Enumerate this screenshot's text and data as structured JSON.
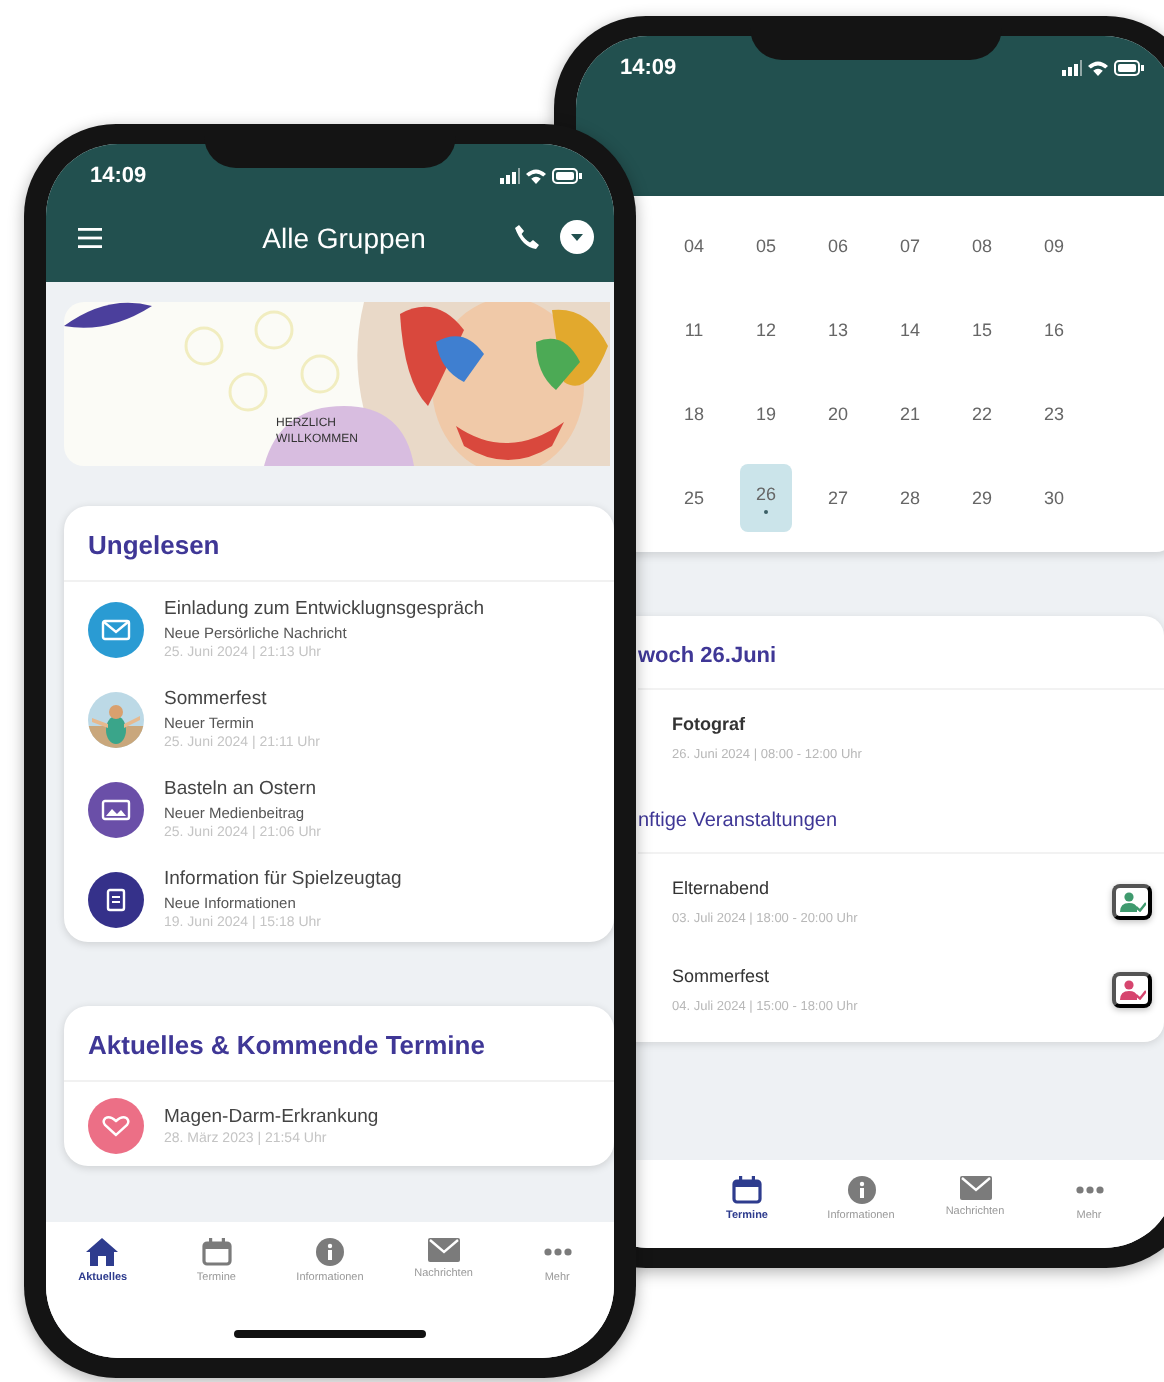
{
  "back_phone": {
    "status_time": "14:09",
    "calendar": [
      [
        {
          "day": "04",
          "selected": false,
          "event": false
        },
        {
          "day": "05",
          "selected": false,
          "event": false
        },
        {
          "day": "06",
          "selected": false,
          "event": false
        },
        {
          "day": "07",
          "selected": false,
          "event": false
        },
        {
          "day": "08",
          "selected": false,
          "event": false
        },
        {
          "day": "09",
          "selected": false,
          "event": false
        }
      ],
      [
        {
          "day": "11",
          "selected": false,
          "event": false
        },
        {
          "day": "12",
          "selected": false,
          "event": false
        },
        {
          "day": "13",
          "selected": false,
          "event": false
        },
        {
          "day": "14",
          "selected": false,
          "event": false
        },
        {
          "day": "15",
          "selected": false,
          "event": false
        },
        {
          "day": "16",
          "selected": false,
          "event": false
        }
      ],
      [
        {
          "day": "18",
          "selected": false,
          "event": false
        },
        {
          "day": "19",
          "selected": false,
          "event": false
        },
        {
          "day": "20",
          "selected": false,
          "event": false
        },
        {
          "day": "21",
          "selected": false,
          "event": false
        },
        {
          "day": "22",
          "selected": false,
          "event": false
        },
        {
          "day": "23",
          "selected": false,
          "event": false
        }
      ],
      [
        {
          "day": "25",
          "selected": false,
          "event": false
        },
        {
          "day": "26",
          "selected": true,
          "event": true
        },
        {
          "day": "27",
          "selected": false,
          "event": false
        },
        {
          "day": "28",
          "selected": false,
          "event": false
        },
        {
          "day": "29",
          "selected": false,
          "event": false
        },
        {
          "day": "30",
          "selected": false,
          "event": false
        }
      ]
    ],
    "day_heading": "woch 26.Juni",
    "today_events": [
      {
        "title": "Fotograf",
        "time": "26. Juni 2024 | 08:00 - 12:00 Uhr"
      }
    ],
    "upcoming_heading": "nftige Veranstaltungen",
    "upcoming": [
      {
        "title": "Elternabend",
        "time": "03. Juli 2024 | 18:00 - 20:00 Uhr",
        "color": "#3f9a6e"
      },
      {
        "title": "Sommerfest",
        "time": "04. Juli 2024 | 15:00 - 18:00 Uhr",
        "color": "#d6456e"
      }
    ],
    "tabs": [
      {
        "label": "Termine",
        "kind": "calendar",
        "selected": true
      },
      {
        "label": "Informationen",
        "kind": "info",
        "selected": false
      },
      {
        "label": "Nachrichten",
        "kind": "mail",
        "selected": false
      },
      {
        "label": "Mehr",
        "kind": "more",
        "selected": false
      }
    ]
  },
  "front_phone": {
    "status_time": "14:09",
    "title": "Alle Gruppen",
    "banner": {
      "text": "HERZLICH WILLKOMMEN"
    },
    "unread": {
      "heading": "Ungelesen",
      "items": [
        {
          "kind": "message",
          "title": "Einladung zum Entwicklugnsgespräch",
          "subtitle": "Neue Persörliche Nachricht",
          "time": "25. Juni 2024 | 21:13 Uhr"
        },
        {
          "kind": "picture",
          "title": "Sommerfest",
          "subtitle": "Neuer Termin",
          "time": "25. Juni 2024 | 21:11 Uhr"
        },
        {
          "kind": "media",
          "title": "Basteln an Ostern",
          "subtitle": "Neuer Medienbeitrag",
          "time": "25. Juni 2024 | 21:06 Uhr"
        },
        {
          "kind": "info",
          "title": "Information für Spielzeugtag",
          "subtitle": "Neue Informationen",
          "time": "19. Juni 2024 | 15:18 Uhr"
        }
      ]
    },
    "news": {
      "heading": "Aktuelles & Kommende Termine",
      "items": [
        {
          "kind": "health",
          "title": "Magen-Darm-Erkrankung",
          "time": "28. März 2023 | 21:54 Uhr"
        }
      ]
    },
    "tabs": [
      {
        "label": "Aktuelles",
        "kind": "home",
        "selected": true
      },
      {
        "label": "Termine",
        "kind": "calendar",
        "selected": false
      },
      {
        "label": "Informationen",
        "kind": "info",
        "selected": false
      },
      {
        "label": "Nachrichten",
        "kind": "mail",
        "selected": false
      },
      {
        "label": "Mehr",
        "kind": "more",
        "selected": false
      }
    ]
  }
}
